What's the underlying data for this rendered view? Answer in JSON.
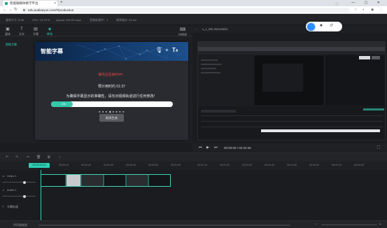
{
  "browser": {
    "tab_title": "智能融媒体教学平台",
    "new_tab": "+",
    "url": "edu.aodianyun.com/#/production",
    "window_controls": "— ▢ ✕"
  },
  "header": {
    "resolution": "画布尺寸 3136",
    "cpu": "CPU: 15.75 %",
    "upload": "upload: 300.00 kbps",
    "memory": "音频处理中：1",
    "frame": "帧率统计: 65 ms"
  },
  "toolbar": {
    "tools": [
      {
        "label": "媒体",
        "icon": "▣"
      },
      {
        "label": "文本",
        "icon": "T"
      },
      {
        "label": "字幕",
        "icon": "▤"
      },
      {
        "label": "转场",
        "icon": "◈"
      }
    ],
    "side_label": "智能字幕",
    "right_button": "快捷键"
  },
  "modal": {
    "title": "智能字幕",
    "warning": "操作正在进行中！",
    "eta": "预计用时约 01:37",
    "message": "为确保字幕显示的准确性，请勿对视频轨道进行任何修改！",
    "progress_label": "4%",
    "progress_value": 0.04,
    "dots": "● ● ● ◀ ● ● ● ●",
    "cancel_button": "取消生成"
  },
  "preview": {
    "title": "v_1_232 2021/05/24",
    "time": "00:00:00 / 02:04:26"
  },
  "record": {
    "record_icon": "record-dot",
    "stop_icon": "■",
    "reset_icon": "↺"
  },
  "timeline": {
    "cursor_time": "00:00:00:00",
    "ticks": [
      "00:00:00",
      "00:00:10",
      "00:00:20",
      "00:00:30",
      "00:00:40",
      "00:00:50",
      "00:01:00",
      "00:01:10",
      "00:01:20",
      "00:01:30",
      "00:01:40",
      "00:01:50",
      "00:02:00",
      "00:02:10",
      "00:02:20"
    ],
    "tracks": [
      "Video 1",
      "Audio 1",
      "字幕轨道"
    ]
  },
  "bottom": {
    "zoom_label": "时间轴缩放"
  }
}
